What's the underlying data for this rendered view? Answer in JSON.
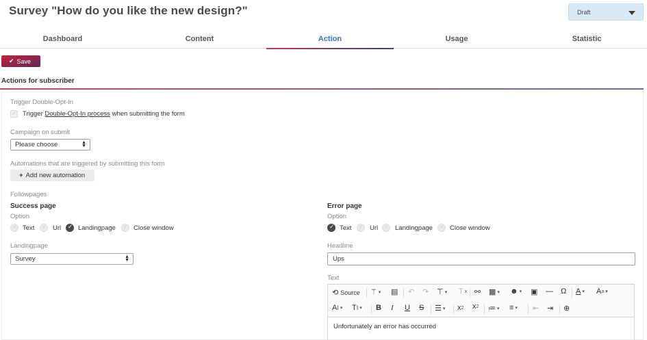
{
  "page_title": "Survey \"How do you like the new design?\"",
  "status": {
    "value": "Draft"
  },
  "tabs": [
    {
      "label": "Dashboard"
    },
    {
      "label": "Content"
    },
    {
      "label": "Action",
      "active": true
    },
    {
      "label": "Usage"
    },
    {
      "label": "Statistic"
    }
  ],
  "save_label": "Save",
  "section_title": "Actions for subscriber",
  "double_opt_in": {
    "label": "Trigger Double-Opt-In",
    "check_prefix": "Trigger",
    "check_link": "Double-Opt-In process",
    "check_suffix": "when submitting the form"
  },
  "campaign": {
    "label": "Campaign on submit",
    "value": "Please choose"
  },
  "automations": {
    "label": "Automations that are triggered by submitting this form",
    "button": "Add new automation"
  },
  "followpages_label": "Followpages",
  "success": {
    "title": "Success page",
    "option_label": "Option",
    "options": [
      "Text",
      "Url",
      "Landingpage",
      "Close window"
    ],
    "selected": "Landingpage",
    "landingpage_label": "Landingpage",
    "landingpage_value": "Survey"
  },
  "error": {
    "title": "Error page",
    "option_label": "Option",
    "options": [
      "Text",
      "Url",
      "Landingpage",
      "Close window"
    ],
    "selected": "Text",
    "headline_label": "Headline",
    "headline_value": "Ups",
    "text_label": "Text",
    "editor": {
      "source_label": "Source",
      "content": "Unfortunately an error has occurred"
    }
  },
  "colors": {
    "accent": "#3d76b8",
    "brand_red": "#c8203a",
    "status_bg": "#d9e9f7"
  },
  "icons": [
    "chevron-down-icon",
    "check-icon",
    "plus-icon",
    "source-icon",
    "magic-wand-icon",
    "clipboard-icon",
    "undo-icon",
    "redo-icon",
    "paint-format-icon",
    "clear-format-icon",
    "link-icon",
    "table-icon",
    "emoji-icon",
    "image-icon",
    "horizontal-line-icon",
    "omega-icon",
    "font-color-icon",
    "font-background-icon",
    "font-size-icon",
    "text-height-icon",
    "bold-icon",
    "italic-icon",
    "underline-icon",
    "strikethrough-icon",
    "align-icon",
    "subscript-icon",
    "superscript-icon",
    "numbered-list-icon",
    "bulleted-list-icon",
    "outdent-icon",
    "indent-icon",
    "anchor-icon"
  ]
}
